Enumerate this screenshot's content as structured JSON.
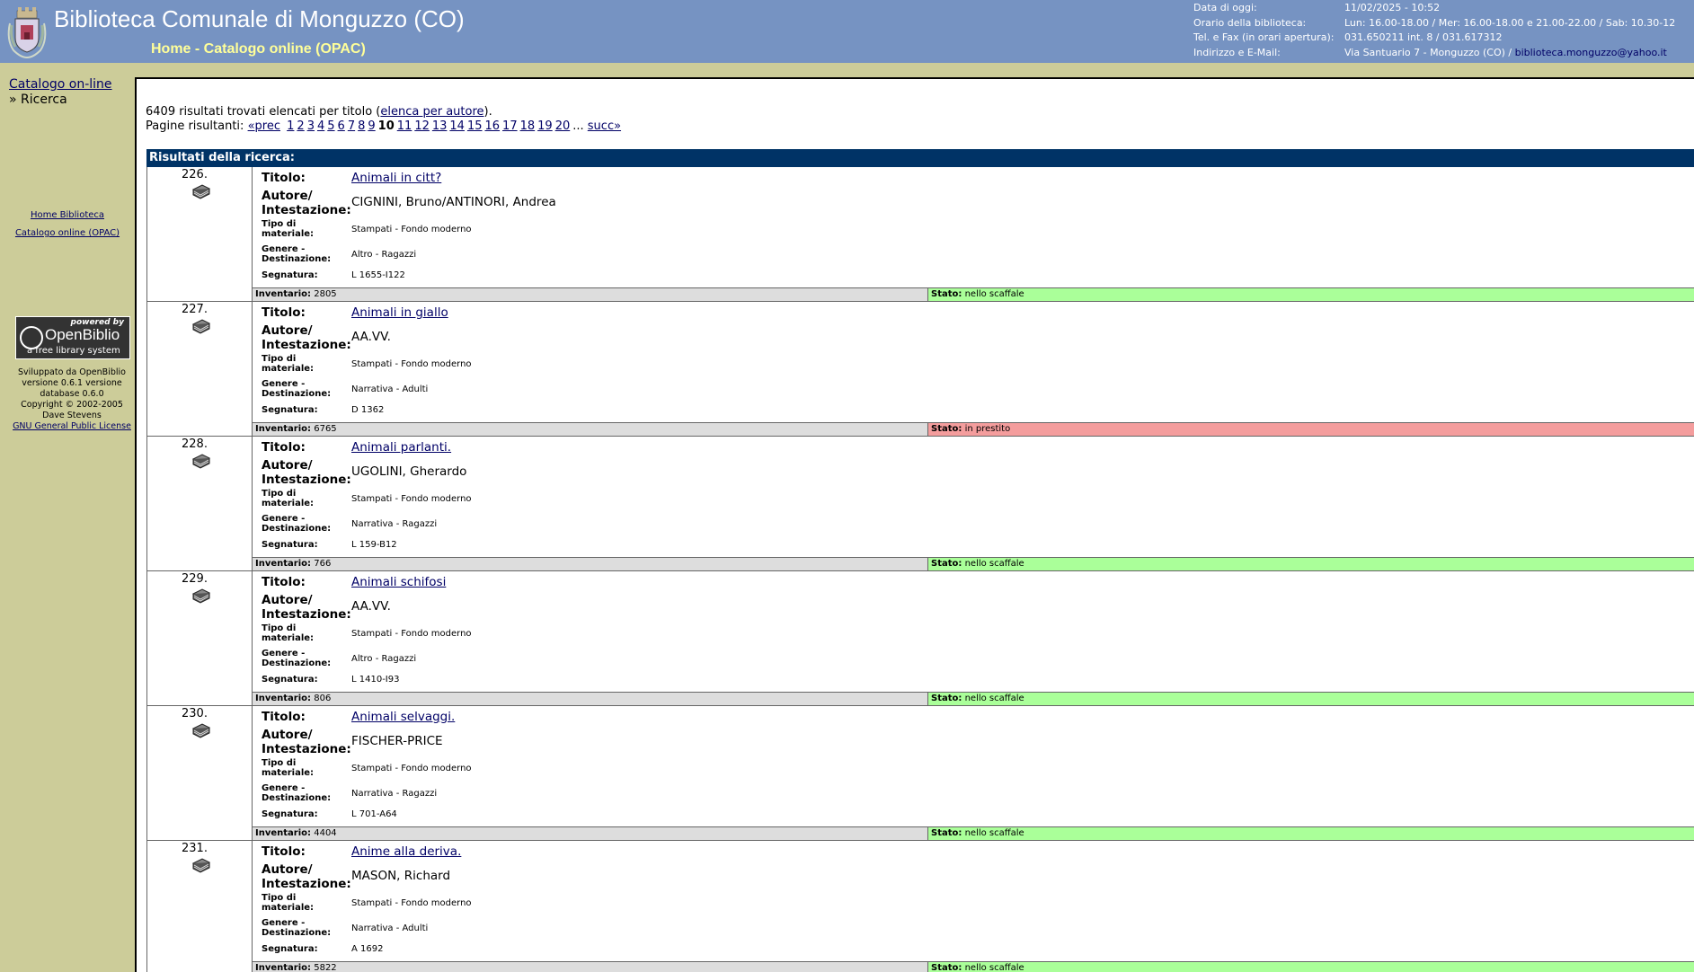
{
  "header": {
    "title": "Biblioteca Comunale di Monguzzo (CO)",
    "nav": "Home - Catalogo online (OPAC)",
    "info": [
      {
        "label": "Data di oggi:",
        "value": "11/02/2025 - 10:52"
      },
      {
        "label": "Orario della biblioteca:",
        "value": "Lun: 16.00-18.00 / Mer: 16.00-18.00 e 21.00-22.00 / Sab: 10.30-12"
      },
      {
        "label": "Tel. e Fax (in orari apertura):",
        "value": "031.650211 int. 8 / 031.617312"
      },
      {
        "label": "Indirizzo e E-Mail:",
        "value": "Via Santuario 7 - Monguzzo (CO) / ",
        "email": "biblioteca.monguzzo@yahoo.it"
      }
    ]
  },
  "sidebar": {
    "catalog_link": "Catalogo on-line",
    "current": "» Ricerca",
    "home_link": "Home Biblioteca",
    "opac_link": "Catalogo online (OPAC)",
    "badge": {
      "powered": "powered by",
      "name": "OpenBiblio",
      "tagline": "a free library system"
    },
    "credits": [
      "Sviluppato da OpenBiblio",
      "versione 0.6.1 versione",
      "database 0.6.0",
      "Copyright © 2002-2005",
      "Dave Stevens"
    ],
    "license_link": "GNU General Public License"
  },
  "main": {
    "summary_prefix": "6409 risultati trovati elencati per titolo (",
    "summary_link": "elenca per autore",
    "summary_suffix": ").",
    "pager_label": "Pagine risultanti:",
    "prev": "«prec",
    "pages_before": [
      "1",
      "2",
      "3",
      "4",
      "5",
      "6",
      "7",
      "8",
      "9"
    ],
    "current_page": "10",
    "pages_after": [
      "11",
      "12",
      "13",
      "14",
      "15",
      "16",
      "17",
      "18",
      "19",
      "20"
    ],
    "ellipsis": "...",
    "next": "succ»",
    "results_header": "Risultati della ricerca:"
  },
  "labels": {
    "titolo": "Titolo:",
    "autore": "Autore/ Intestazione:",
    "tipo": "Tipo di materiale:",
    "genere": "Genere - Destinazione:",
    "segnatura": "Segnatura:",
    "inventario": "Inventario:",
    "stato": "Stato:"
  },
  "colors": {
    "available": "#aaff99",
    "on_loan": "#f49d9d"
  },
  "results": [
    {
      "num": "226.",
      "titolo": "Animali in citt?",
      "autore": "CIGNINI, Bruno/ANTINORI, Andrea",
      "tipo": "Stampati - Fondo moderno",
      "genere": "Altro - Ragazzi",
      "segnatura": "L 1655-I122",
      "inventario": "2805",
      "stato": "nello scaffale",
      "status": "available"
    },
    {
      "num": "227.",
      "titolo": "Animali in giallo",
      "autore": "AA.VV.",
      "tipo": "Stampati - Fondo moderno",
      "genere": "Narrativa - Adulti",
      "segnatura": "D 1362",
      "inventario": "6765",
      "stato": "in prestito",
      "status": "on_loan"
    },
    {
      "num": "228.",
      "titolo": "Animali parlanti.",
      "autore": "UGOLINI, Gherardo",
      "tipo": "Stampati - Fondo moderno",
      "genere": "Narrativa - Ragazzi",
      "segnatura": "L 159-B12",
      "inventario": "766",
      "stato": "nello scaffale",
      "status": "available"
    },
    {
      "num": "229.",
      "titolo": "Animali schifosi",
      "autore": "AA.VV.",
      "tipo": "Stampati - Fondo moderno",
      "genere": "Altro - Ragazzi",
      "segnatura": "L 1410-I93",
      "inventario": "806",
      "stato": "nello scaffale",
      "status": "available"
    },
    {
      "num": "230.",
      "titolo": "Animali selvaggi.",
      "autore": "FISCHER-PRICE",
      "tipo": "Stampati - Fondo moderno",
      "genere": "Narrativa - Ragazzi",
      "segnatura": "L 701-A64",
      "inventario": "4404",
      "stato": "nello scaffale",
      "status": "available"
    },
    {
      "num": "231.",
      "titolo": "Anime alla deriva.",
      "autore": "MASON, Richard",
      "tipo": "Stampati - Fondo moderno",
      "genere": "Narrativa - Adulti",
      "segnatura": "A 1692",
      "inventario": "5822",
      "stato": "nello scaffale",
      "status": "available"
    }
  ]
}
